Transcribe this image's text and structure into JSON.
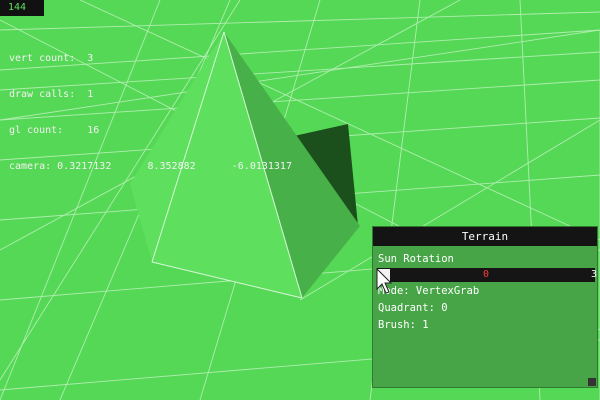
{
  "fps": "144",
  "stats": {
    "vert_count": "vert count:  3",
    "draw_calls": "draw calls:  1",
    "gl_count": "gl count:    16",
    "camera": "camera: 0.3217132      8.352882      -6.0131317"
  },
  "panel": {
    "title": "Terrain",
    "sun_rotation_label": "Sun Rotation",
    "slider_value": "0",
    "slider_max": "3",
    "mode": "Mode: VertexGrab",
    "quadrant": "Quadrant: 0",
    "brush": "Brush: 1"
  },
  "colors": {
    "ground": "#55d855",
    "pyramid_light": "#5ee05e",
    "pyramid_dark": "#48b048",
    "shadow": "#1b4f1b",
    "panel_bg": "#47a547",
    "title_bg": "#141414",
    "slider_value": "#ff3a3a"
  },
  "icons": [
    "mouse-cursor-icon",
    "resize-handle-icon"
  ]
}
